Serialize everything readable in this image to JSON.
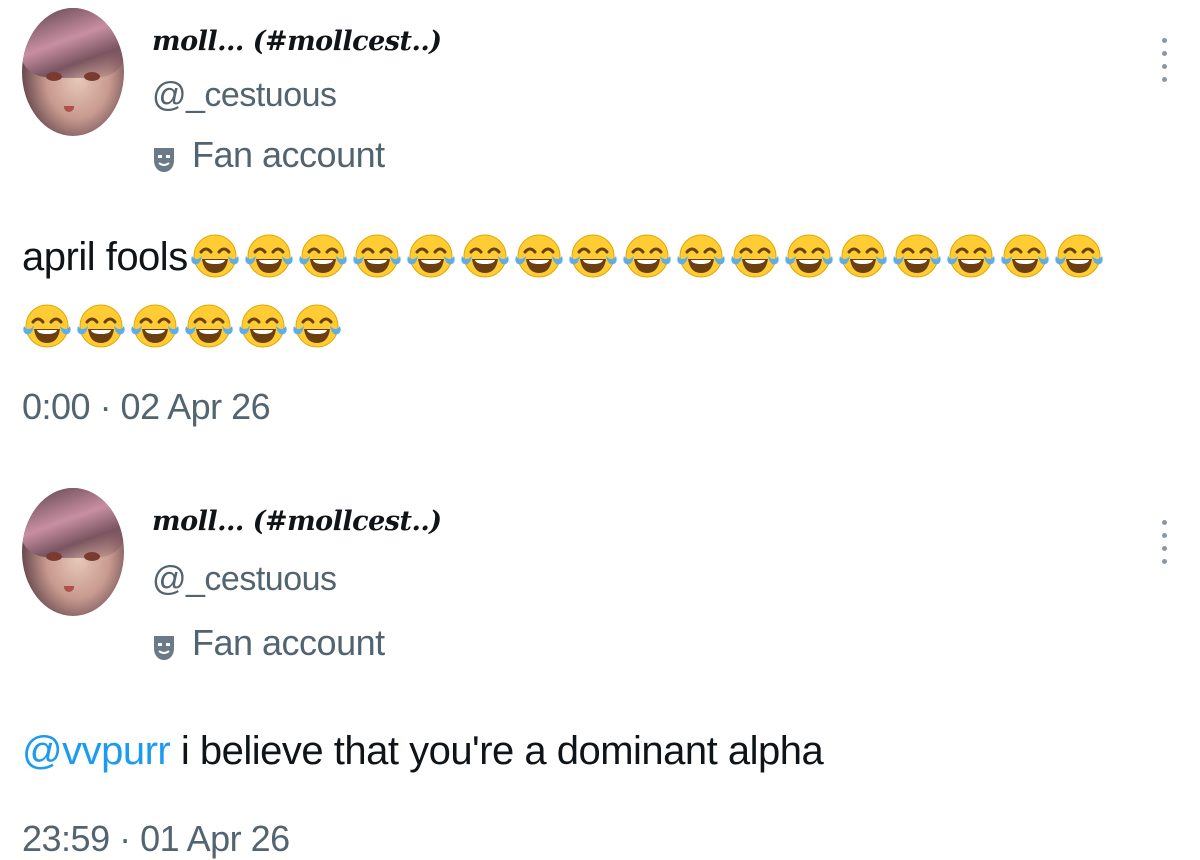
{
  "tweets": [
    {
      "display_name": "moll... (#mollcest..)",
      "handle": "@_cestuous",
      "label": "Fan account",
      "text_prefix": "april fools",
      "emoji_line1_count": 17,
      "emoji_line2_count": 6,
      "emoji": "face-with-tears-of-joy",
      "timestamp": "0:00 · 02 Apr 26"
    },
    {
      "display_name": "moll... (#mollcest..)",
      "handle": "@_cestuous",
      "label": "Fan account",
      "mention": "@vvpurr",
      "text": " i believe that you're a dominant alpha",
      "timestamp": "23:59 · 01 Apr 26"
    }
  ],
  "icons": {
    "label_icon": "theater-mask-icon",
    "more_icon": "more-vertical-icon"
  },
  "colors": {
    "mention": "#1d9bf0",
    "secondary_text": "#536471",
    "primary_text": "#0f1419",
    "emoji_face": "#ffcc33",
    "emoji_tears": "#5dadec"
  }
}
